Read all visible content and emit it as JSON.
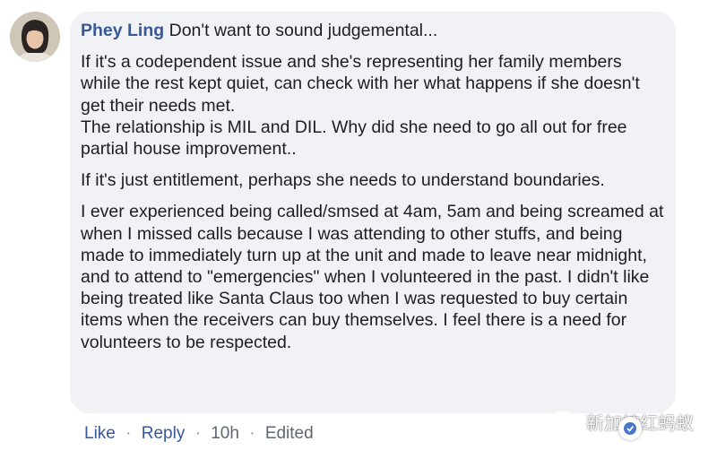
{
  "comment": {
    "author": "Phey Ling",
    "paragraphs": [
      "Don't want to sound judgemental...",
      "If it's a codependent issue and she's representing her family members while the rest kept quiet, can check with her what happens if she doesn't get their needs met.\nThe relationship is MIL and DIL. Why did she need to go all out for free partial house improvement..",
      "If it's just entitlement, perhaps she needs to understand boundaries.",
      "I ever experienced being called/smsed at 4am, 5am and being screamed at when I missed calls because I was attending to other stuffs, and being made to immediately turn up at the unit and made to leave near midnight, and to attend to \"emergencies\" when I volunteered in the past. I didn't like being treated like Santa Claus too when I was requested to buy certain items when the receivers can buy themselves. I feel there is a need for volunteers to be respected."
    ]
  },
  "actions": {
    "like": "Like",
    "reply": "Reply",
    "time": "10h",
    "edited": "Edited",
    "separator": "·"
  },
  "watermark": {
    "text": "新加坡红蚂蚁",
    "icon": "wechat-icon"
  },
  "colors": {
    "bubble": "#f0f2f5",
    "author": "#385898",
    "text": "#1c1e21",
    "meta": "#606770"
  }
}
